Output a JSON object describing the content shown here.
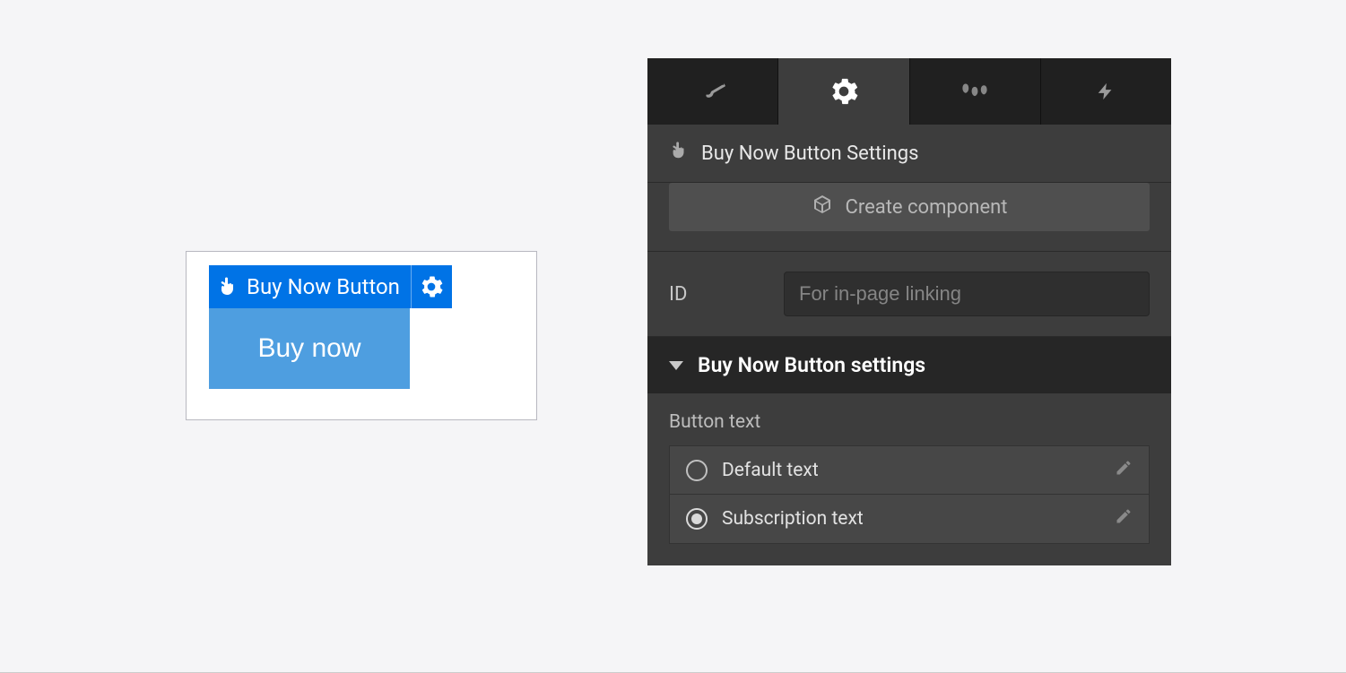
{
  "canvas": {
    "element_label": "Buy Now Button",
    "button_text": "Buy now"
  },
  "panel": {
    "header_title": "Buy Now Button Settings",
    "create_component_label": "Create component",
    "id_label": "ID",
    "id_placeholder": "For in-page linking",
    "accordion_title": "Buy Now Button settings",
    "button_text_label": "Button text",
    "options": {
      "default_text": "Default text",
      "subscription_text": "Subscription text"
    }
  }
}
